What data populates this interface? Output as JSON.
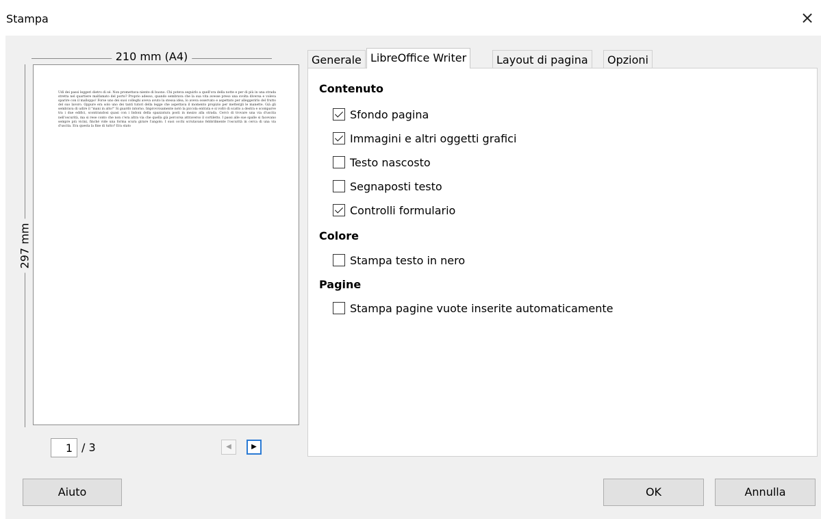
{
  "window": {
    "title": "Stampa",
    "close_glyph": "×"
  },
  "preview": {
    "width_label": "210 mm (A4)",
    "height_label": "297 mm",
    "page_text": "Udì dei passi leggeri dietro di sé. Non promettava niente di buono. Chi poteva seguirlo a quell'ora della notte e per di più in una strada stretta nel quartiere malfamato del porto? Proprio adesso, quando sembrava che la sua vita avesse preso una svolta diversa e voleva sparire con il malloppo! Forse uno dei suoi colleghi aveva avuto la stessa idea, lo aveva osservato e aspettato per alleggerirlo del frutto del suo lavoro. Oppure era solo uno dei tanti tutori della legge che aspettava il momento propizio per mettergli le manette. Già gli sembrava di udire il \"mani in alto!\" Si guardò intorno. Improvvisamente notò la piccola entrata e si voltò di scatto a destra e scomparve tra i due edifici, scontrandosi quasi con i bidoni della spazzatura posti in mezzo alla strada. Cercò di trovare una via d'uscita nell'oscurità, ma si rese conto che non c'era altra via che quella già percorsa attraverso il cortiletto. I passi alle sue spalle si facevano sempre più vicini, finché vide una forma scura girare l'angolo. I suoi occhi scrutavano febbrilmente l'oscurità in cerca di una via d'uscita. Era questa la fine di tutto? Era stato",
    "current_page": "1",
    "total_pages": "/ 3",
    "prev_glyph": "◀",
    "next_glyph": "▶"
  },
  "tabs": [
    {
      "label": "Generale"
    },
    {
      "label": "LibreOffice Writer"
    },
    {
      "label": "Layout di pagina"
    },
    {
      "label": "Opzioni"
    }
  ],
  "active_tab": "LibreOffice Writer",
  "panel": {
    "contenuto_title": "Contenuto",
    "contenuto": [
      {
        "label": "Sfondo pagina",
        "checked": true
      },
      {
        "label": "Immagini e altri oggetti grafici",
        "checked": true
      },
      {
        "label": "Testo nascosto",
        "checked": false
      },
      {
        "label": "Segnaposti testo",
        "checked": false
      },
      {
        "label": "Controlli formulario",
        "checked": true
      }
    ],
    "colore_title": "Colore",
    "colore": [
      {
        "label": "Stampa testo in nero",
        "checked": false
      }
    ],
    "pagine_title": "Pagine",
    "pagine": [
      {
        "label": "Stampa pagine vuote inserite automaticamente",
        "checked": false
      }
    ]
  },
  "buttons": {
    "help": "Aiuto",
    "ok": "OK",
    "cancel": "Annulla"
  }
}
